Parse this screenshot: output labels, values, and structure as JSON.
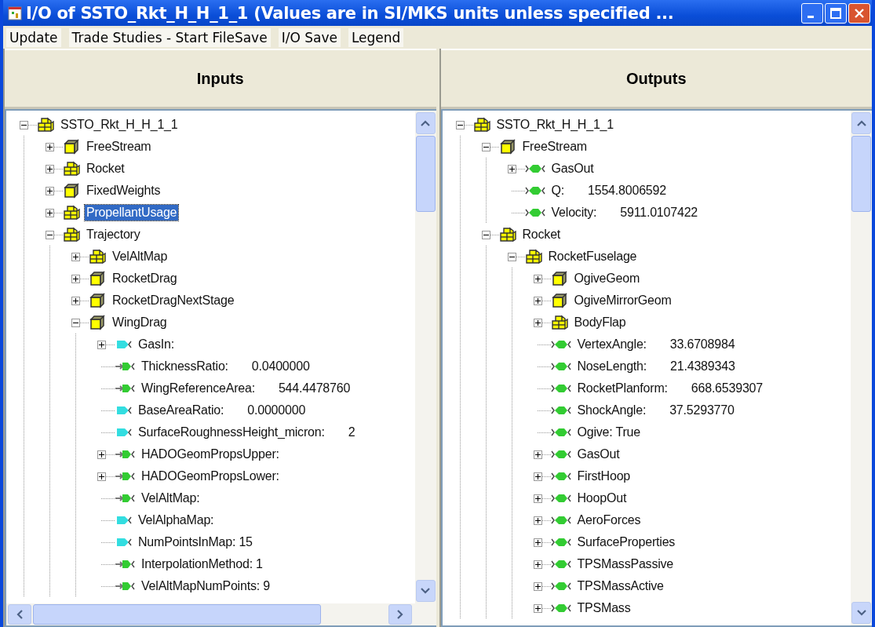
{
  "window": {
    "title": "I/O of SSTO_Rkt_H_H_1_1 (Values are in SI/MKS units unless specified ..."
  },
  "menu": [
    "Update",
    "Trade Studies - Start FileSave",
    "I/O Save",
    "Legend"
  ],
  "panels": [
    {
      "title": "Inputs",
      "horizontal_scrollbar": true,
      "tree": [
        {
          "kind": "assembly",
          "label": "SSTO_Rkt_H_H_1_1",
          "expanded": true,
          "selected": false,
          "children": [
            {
              "kind": "component",
              "label": "FreeStream",
              "expanded": false,
              "selected": false
            },
            {
              "kind": "assembly",
              "label": "Rocket",
              "expanded": false,
              "selected": false
            },
            {
              "kind": "component",
              "label": "FixedWeights",
              "expanded": false,
              "selected": false
            },
            {
              "kind": "assembly",
              "label": "PropellantUsage",
              "expanded": false,
              "selected": true
            },
            {
              "kind": "assembly",
              "label": "Trajectory",
              "expanded": true,
              "selected": false,
              "children": [
                {
                  "kind": "assembly",
                  "label": "VelAltMap",
                  "expanded": false,
                  "selected": false
                },
                {
                  "kind": "component",
                  "label": "RocketDrag",
                  "expanded": false,
                  "selected": false
                },
                {
                  "kind": "component",
                  "label": "RocketDragNextStage",
                  "expanded": false,
                  "selected": false
                },
                {
                  "kind": "component",
                  "label": "WingDrag",
                  "expanded": true,
                  "selected": false,
                  "children": [
                    {
                      "kind": "input",
                      "label": "GasIn:",
                      "expanded": false,
                      "selected": false
                    },
                    {
                      "kind": "linked-input",
                      "label": "ThicknessRatio:",
                      "value": "0.0400000",
                      "selected": false
                    },
                    {
                      "kind": "linked-input",
                      "label": "WingReferenceArea:",
                      "value": "544.4478760",
                      "selected": false
                    },
                    {
                      "kind": "input",
                      "label": "BaseAreaRatio:",
                      "value": "0.0000000",
                      "selected": false
                    },
                    {
                      "kind": "input",
                      "label": "SurfaceRoughnessHeight_micron:",
                      "value": "2",
                      "selected": false
                    },
                    {
                      "kind": "linked-input",
                      "label": "HADOGeomPropsUpper:",
                      "expanded": false,
                      "selected": false
                    },
                    {
                      "kind": "linked-input",
                      "label": "HADOGeomPropsLower:",
                      "expanded": false,
                      "selected": false
                    },
                    {
                      "kind": "linked-input",
                      "label": "VelAltMap:",
                      "selected": false
                    },
                    {
                      "kind": "input",
                      "label": "VelAlphaMap:",
                      "selected": false
                    },
                    {
                      "kind": "input",
                      "label": "NumPointsInMap: 15",
                      "selected": false
                    },
                    {
                      "kind": "linked-input",
                      "label": "InterpolationMethod: 1",
                      "selected": false
                    },
                    {
                      "kind": "linked-input",
                      "label": "VelAltMapNumPoints: 9",
                      "selected": false
                    }
                  ]
                }
              ]
            }
          ]
        }
      ]
    },
    {
      "title": "Outputs",
      "horizontal_scrollbar": false,
      "tree": [
        {
          "kind": "assembly",
          "label": "SSTO_Rkt_H_H_1_1",
          "expanded": true,
          "selected": false,
          "children": [
            {
              "kind": "component",
              "label": "FreeStream",
              "expanded": true,
              "selected": false,
              "children": [
                {
                  "kind": "output",
                  "label": "GasOut",
                  "expanded": false,
                  "selected": false
                },
                {
                  "kind": "output",
                  "label": "Q:",
                  "value": "1554.8006592",
                  "selected": false
                },
                {
                  "kind": "output",
                  "label": "Velocity:",
                  "value": "5911.0107422",
                  "selected": false
                }
              ]
            },
            {
              "kind": "assembly",
              "label": "Rocket",
              "expanded": true,
              "selected": false,
              "children": [
                {
                  "kind": "assembly",
                  "label": "RocketFuselage",
                  "expanded": true,
                  "selected": false,
                  "children": [
                    {
                      "kind": "component",
                      "label": "OgiveGeom",
                      "expanded": false,
                      "selected": false
                    },
                    {
                      "kind": "component",
                      "label": "OgiveMirrorGeom",
                      "expanded": false,
                      "selected": false
                    },
                    {
                      "kind": "assembly",
                      "label": "BodyFlap",
                      "expanded": false,
                      "selected": false
                    },
                    {
                      "kind": "output",
                      "label": "VertexAngle:",
                      "value": "33.6708984",
                      "selected": false
                    },
                    {
                      "kind": "output",
                      "label": "NoseLength:",
                      "value": "21.4389343",
                      "selected": false
                    },
                    {
                      "kind": "output",
                      "label": "RocketPlanform:",
                      "value": "668.6539307",
                      "selected": false
                    },
                    {
                      "kind": "output",
                      "label": "ShockAngle:",
                      "value": "37.5293770",
                      "selected": false
                    },
                    {
                      "kind": "output",
                      "label": "Ogive: True",
                      "selected": false
                    },
                    {
                      "kind": "output",
                      "label": "GasOut",
                      "expanded": false,
                      "selected": false
                    },
                    {
                      "kind": "output",
                      "label": "FirstHoop",
                      "expanded": false,
                      "selected": false
                    },
                    {
                      "kind": "output",
                      "label": "HoopOut",
                      "expanded": false,
                      "selected": false
                    },
                    {
                      "kind": "output",
                      "label": "AeroForces",
                      "expanded": false,
                      "selected": false
                    },
                    {
                      "kind": "output",
                      "label": "SurfaceProperties",
                      "expanded": false,
                      "selected": false
                    },
                    {
                      "kind": "output",
                      "label": "TPSMassPassive",
                      "expanded": false,
                      "selected": false
                    },
                    {
                      "kind": "output",
                      "label": "TPSMassActive",
                      "expanded": false,
                      "selected": false
                    },
                    {
                      "kind": "output",
                      "label": "TPSMass",
                      "expanded": false,
                      "selected": false
                    }
                  ]
                }
              ]
            }
          ]
        }
      ]
    }
  ]
}
